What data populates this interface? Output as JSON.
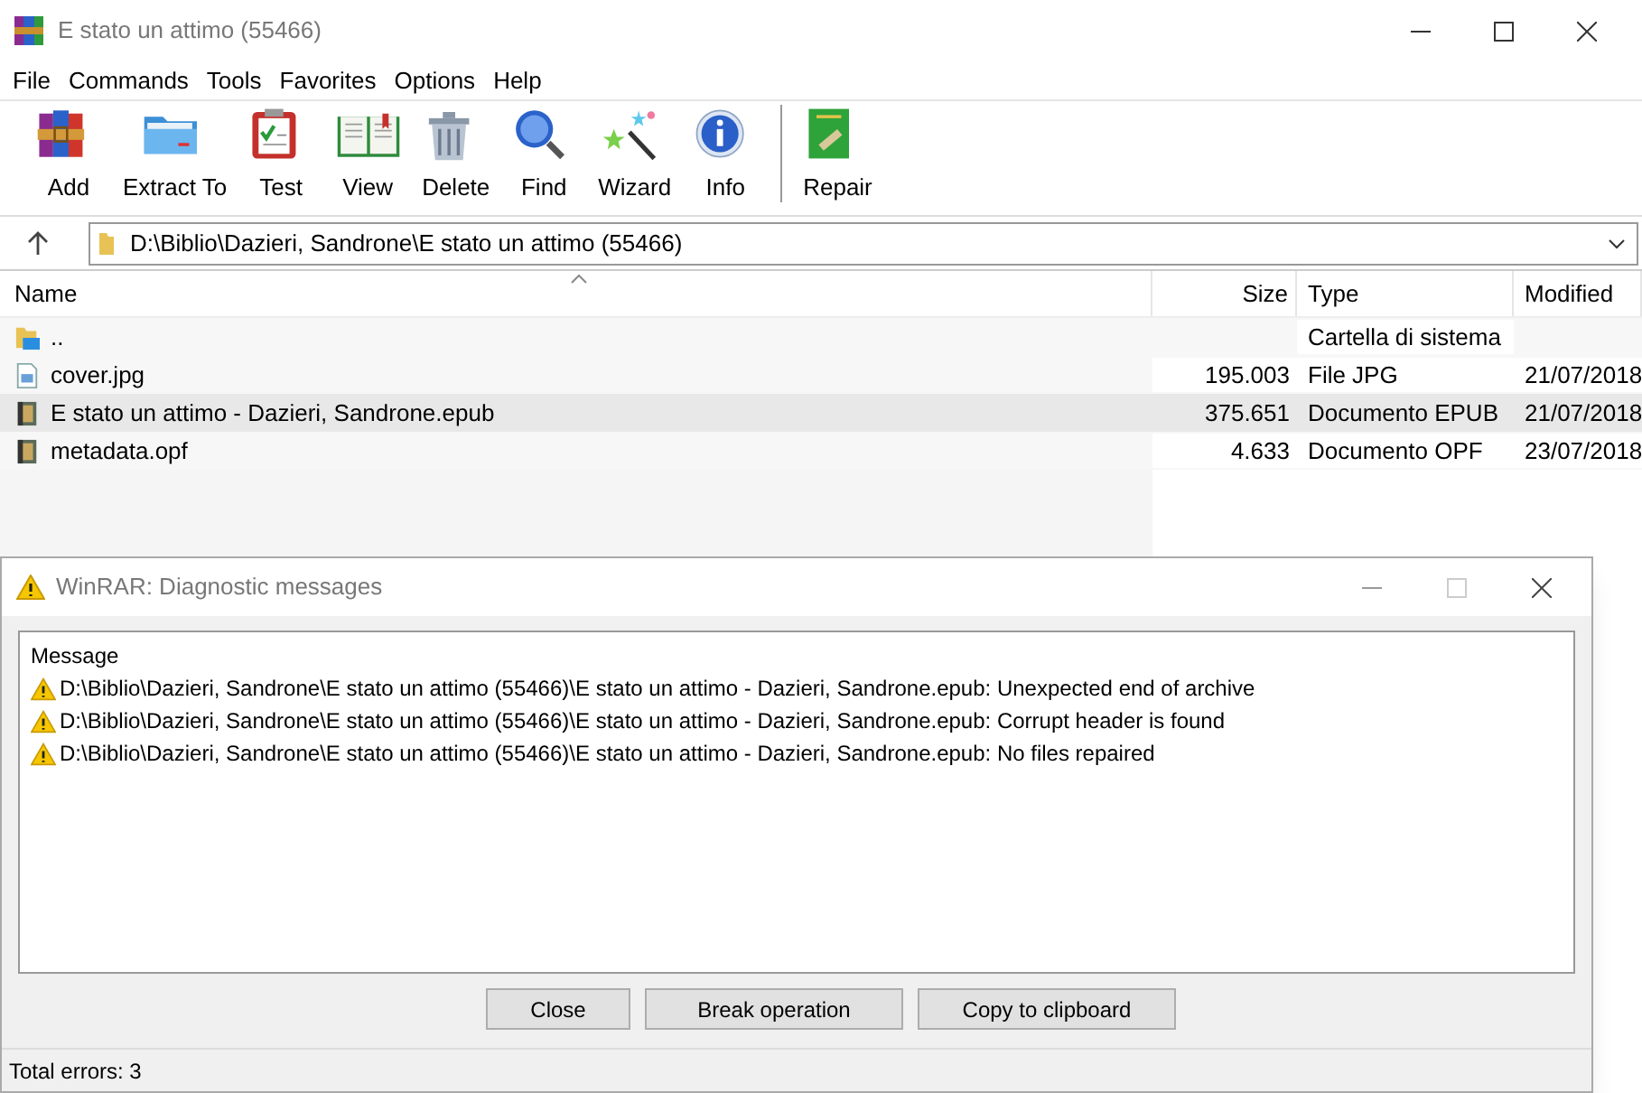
{
  "window": {
    "title": "E stato un attimo (55466)"
  },
  "menu": [
    "File",
    "Commands",
    "Tools",
    "Favorites",
    "Options",
    "Help"
  ],
  "toolbar": [
    {
      "label": "Add"
    },
    {
      "label": "Extract To"
    },
    {
      "label": "Test"
    },
    {
      "label": "View"
    },
    {
      "label": "Delete"
    },
    {
      "label": "Find"
    },
    {
      "label": "Wizard"
    },
    {
      "label": "Info"
    },
    {
      "label": "Repair"
    }
  ],
  "path": {
    "value": "D:\\Biblio\\Dazieri, Sandrone\\E stato un attimo (55466)"
  },
  "table": {
    "columns": [
      "Name",
      "Size",
      "Type",
      "Modified"
    ],
    "rows": [
      {
        "kind": "parent",
        "name": "..",
        "size": "",
        "type": "Cartella di sistema",
        "modified": "",
        "selected": false
      },
      {
        "kind": "image",
        "name": "cover.jpg",
        "size": "195.003",
        "type": "File JPG",
        "modified": "21/07/2018",
        "selected": false
      },
      {
        "kind": "ebook",
        "name": "E stato un attimo - Dazieri, Sandrone.epub",
        "size": "375.651",
        "type": "Documento EPUB",
        "modified": "21/07/2018",
        "selected": true
      },
      {
        "kind": "ebook",
        "name": "metadata.opf",
        "size": "4.633",
        "type": "Documento OPF",
        "modified": "23/07/2018",
        "selected": false
      }
    ]
  },
  "dialog": {
    "title": "WinRAR: Diagnostic messages",
    "column": "Message",
    "messages": [
      "D:\\Biblio\\Dazieri, Sandrone\\E stato un attimo (55466)\\E stato un attimo - Dazieri, Sandrone.epub: Unexpected end of archive",
      "D:\\Biblio\\Dazieri, Sandrone\\E stato un attimo (55466)\\E stato un attimo - Dazieri, Sandrone.epub: Corrupt header is found",
      "D:\\Biblio\\Dazieri, Sandrone\\E stato un attimo (55466)\\E stato un attimo - Dazieri, Sandrone.epub: No files repaired"
    ],
    "buttons": [
      "Close",
      "Break operation",
      "Copy to clipboard"
    ],
    "status": "Total errors: 3"
  }
}
